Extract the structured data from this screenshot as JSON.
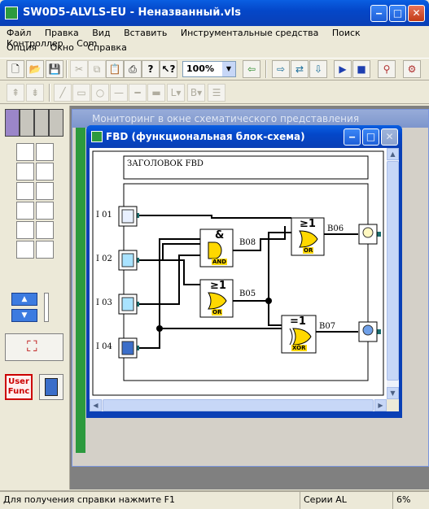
{
  "app": {
    "title": "SW0D5-ALVLS-EU - Неназванный.vls",
    "menu_row1": [
      "Файл",
      "Правка",
      "Вид",
      "Вставить",
      "Инструментальные средства",
      "Поиск",
      "Контроллер",
      "Com"
    ],
    "menu_row2": [
      "Опция",
      "Окно",
      "Справка"
    ],
    "zoom": "100%"
  },
  "palette": {
    "user_func_label": "User Func"
  },
  "bg_window": {
    "title": "Мониторинг в окне схематического представления"
  },
  "fbd_window": {
    "title": "FBD (функциональная блок-схема)",
    "header_label": "ЗАГОЛОВОК FBD",
    "inputs": [
      "I 01",
      "I 02",
      "I 03",
      "I 04"
    ],
    "outputs": [
      "B08",
      "B05",
      "B06",
      "B07"
    ],
    "gates": {
      "and": {
        "symbol": "&",
        "tag": "AND"
      },
      "or1": {
        "symbol": "≥1",
        "tag": "OR"
      },
      "or2": {
        "symbol": "≥1",
        "tag": "OR"
      },
      "xor": {
        "symbol": "=1",
        "tag": "XOR"
      }
    }
  },
  "status_bar": {
    "help": "Для получения справки нажмите F1",
    "series": "Серии AL",
    "percent": "6%"
  },
  "colors": {
    "title_blue": "#0a5fe2",
    "workspace_gray": "#808080",
    "fbd_bg": "#ffffff",
    "gate_yellow": "#ffd800"
  }
}
